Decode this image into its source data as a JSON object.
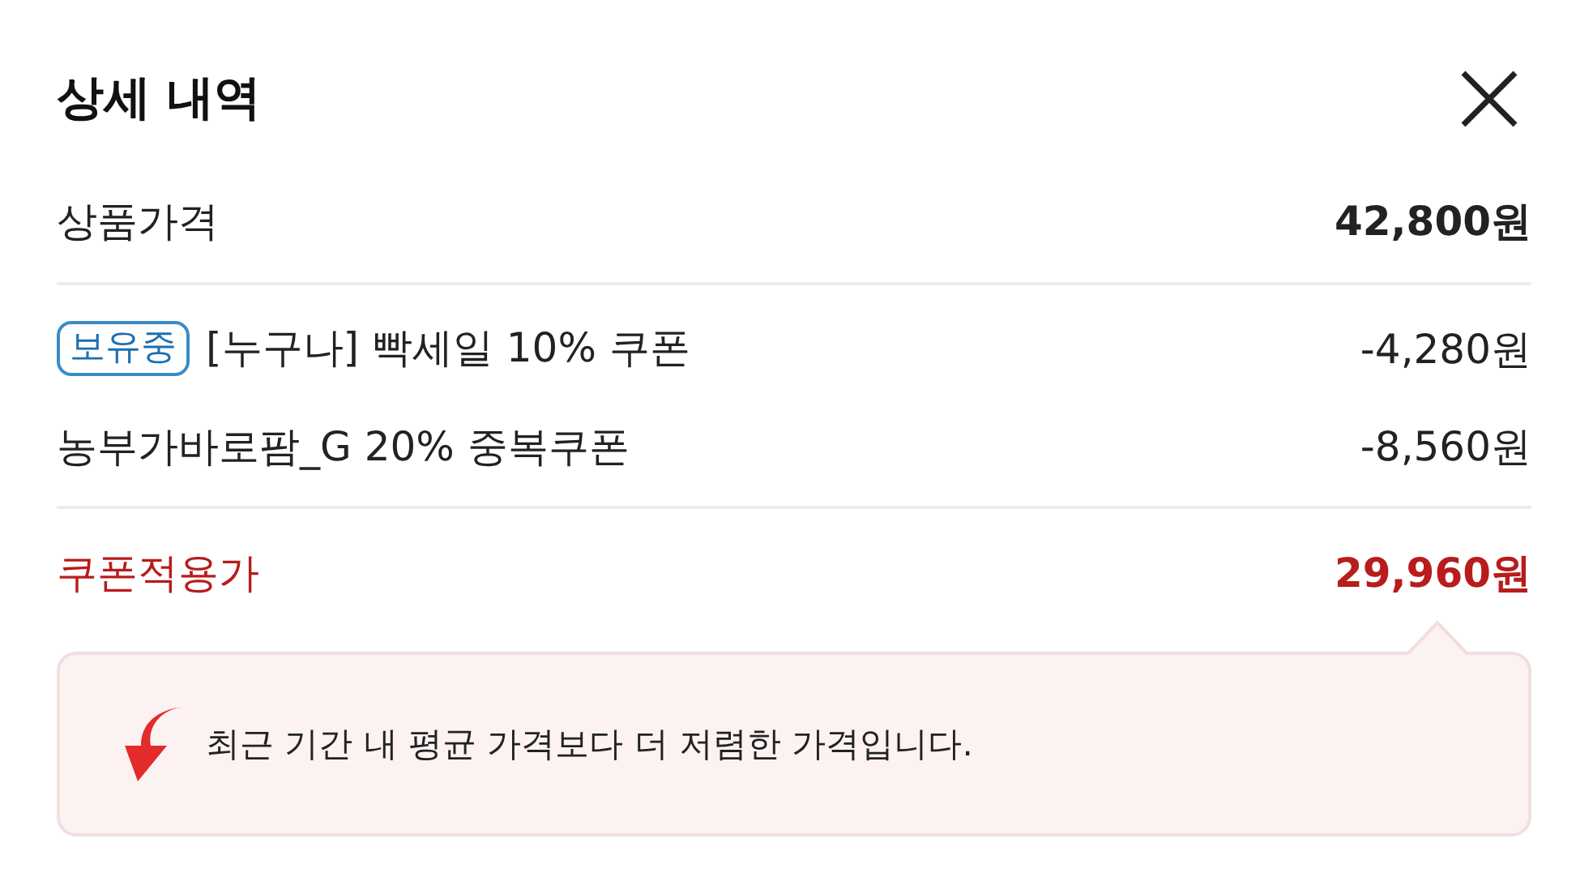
{
  "title": "상세 내역",
  "base": {
    "label": "상품가격",
    "amount": "42,800원"
  },
  "coupons": [
    {
      "badge": "보유중",
      "label": "[누구나] 빡세일 10% 쿠폰",
      "amount": "-4,280원"
    },
    {
      "label": "농부가바로팜_G 20% 중복쿠폰",
      "amount": "-8,560원"
    }
  ],
  "total": {
    "label": "쿠폰적용가",
    "amount": "29,960원"
  },
  "notice": "최근 기간 내 평균 가격보다 더 저렴한 가격입니다."
}
